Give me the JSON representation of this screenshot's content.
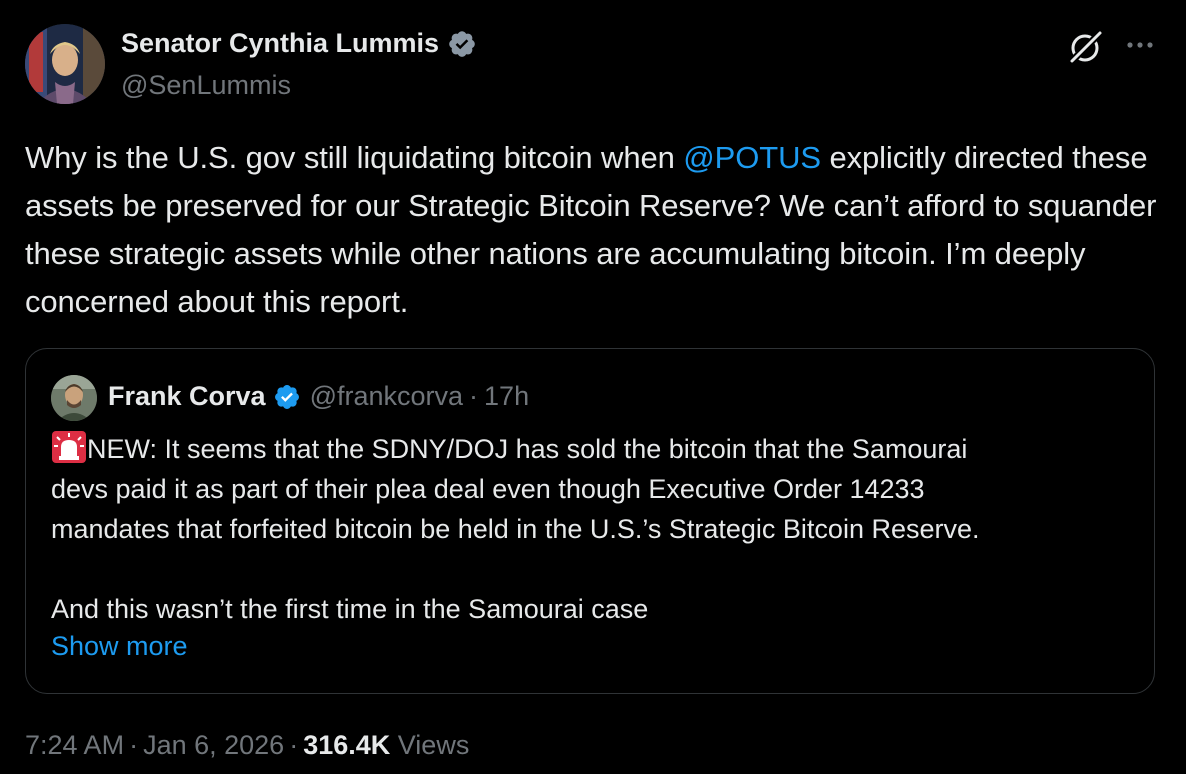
{
  "tweet": {
    "author": {
      "name": "Senator Cynthia Lummis",
      "handle": "@SenLummis"
    },
    "text_before_mention": "Why is the U.S. gov still liquidating bitcoin when ",
    "mention": "@POTUS",
    "text_after_mention": " explicitly directed these assets be preserved for our Strategic Bitcoin Reserve? We can’t afford to squander these strategic assets while other nations are accumulating bitcoin. I’m deeply concerned about this report.",
    "time": "7:24 AM",
    "date": "Jan 6, 2026",
    "views_count": "316.4K",
    "views_label": "Views",
    "separator": "·"
  },
  "quoted_tweet": {
    "author": {
      "name": "Frank Corva",
      "handle": "@frankcorva"
    },
    "separator": "·",
    "time_ago": "17h",
    "lines": [
      "NEW: It seems that the SDNY/DOJ has sold the bitcoin that the Samourai",
      "devs paid it as part of their plea deal even though Executive Order 14233",
      "mandates that forfeited bitcoin be held in the U.S.’s Strategic Bitcoin Reserve."
    ],
    "line_after_break": "And this wasn’t the first time in the Samourai case",
    "show_more_label": "Show more"
  },
  "icons": {
    "verified": "verified-badge-icon",
    "grok": "grok-icon",
    "more": "more-options-icon",
    "siren": "rotating-light-emoji"
  },
  "colors": {
    "background": "#000000",
    "text": "#e7e9ea",
    "muted": "#71767b",
    "accent": "#1d9bf0",
    "border": "#2f3336"
  }
}
